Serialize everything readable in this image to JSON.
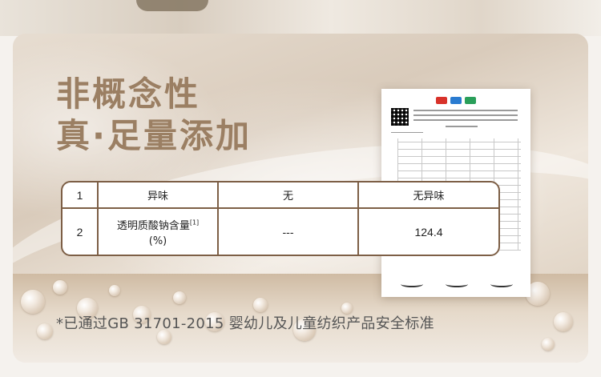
{
  "headline": {
    "line1": "非概念性",
    "line2": "真·足量添加"
  },
  "table": {
    "rows": [
      {
        "no": "1",
        "item": "异味",
        "standard": "无",
        "result": "无异味",
        "ref": ""
      },
      {
        "no": "2",
        "item": "透明质酸钠含量",
        "ref": "[1]",
        "unit": "(%)",
        "standard": "---",
        "result": "124.4"
      }
    ]
  },
  "footnote": "*已通过GB 31701-2015 婴幼儿及儿童纺织产品安全标准",
  "colors": {
    "headline": "#9b7f63",
    "table_border": "#7d5f46"
  }
}
